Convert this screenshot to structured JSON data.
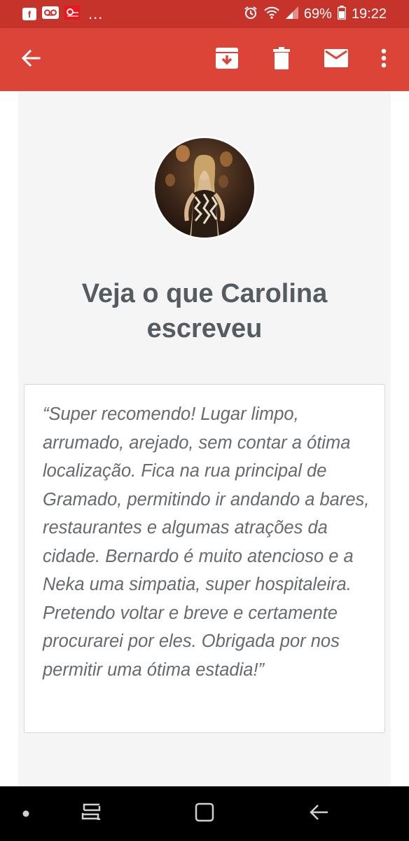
{
  "status_bar": {
    "battery": "69%",
    "time": "19:22",
    "overflow": "...",
    "icons": [
      "facebook-icon",
      "voicemail-icon",
      "app-notification-icon",
      "alarm-icon",
      "wifi-icon",
      "signal-icon",
      "battery-icon"
    ]
  },
  "app_bar": {
    "icons": [
      "back-arrow-icon",
      "archive-icon",
      "delete-icon",
      "mail-icon",
      "more-vert-icon"
    ]
  },
  "email": {
    "heading": "Veja o que Carolina escreveu",
    "review": "“Super recomendo! Lugar limpo, arrumado, arejado, sem contar a ótima localização. Fica na rua principal de Gramado, permitindo ir andando a bares, restaurantes e algumas atrações da cidade. Bernardo é muito atencioso e a Neka uma simpatia, super hospitaleira. Pretendo voltar e breve e certamente procurarei por eles. Obrigada por nos permitir uma ótima estadia!”"
  },
  "nav_bar": {
    "icons": [
      "dot-indicator-icon",
      "recent-apps-icon",
      "home-icon",
      "back-icon"
    ]
  },
  "colors": {
    "status_bar": "#c6332b",
    "app_bar": "#db4437",
    "email_background": "#f5f5f5",
    "heading_text": "#555b60",
    "review_text": "#666a6e"
  }
}
